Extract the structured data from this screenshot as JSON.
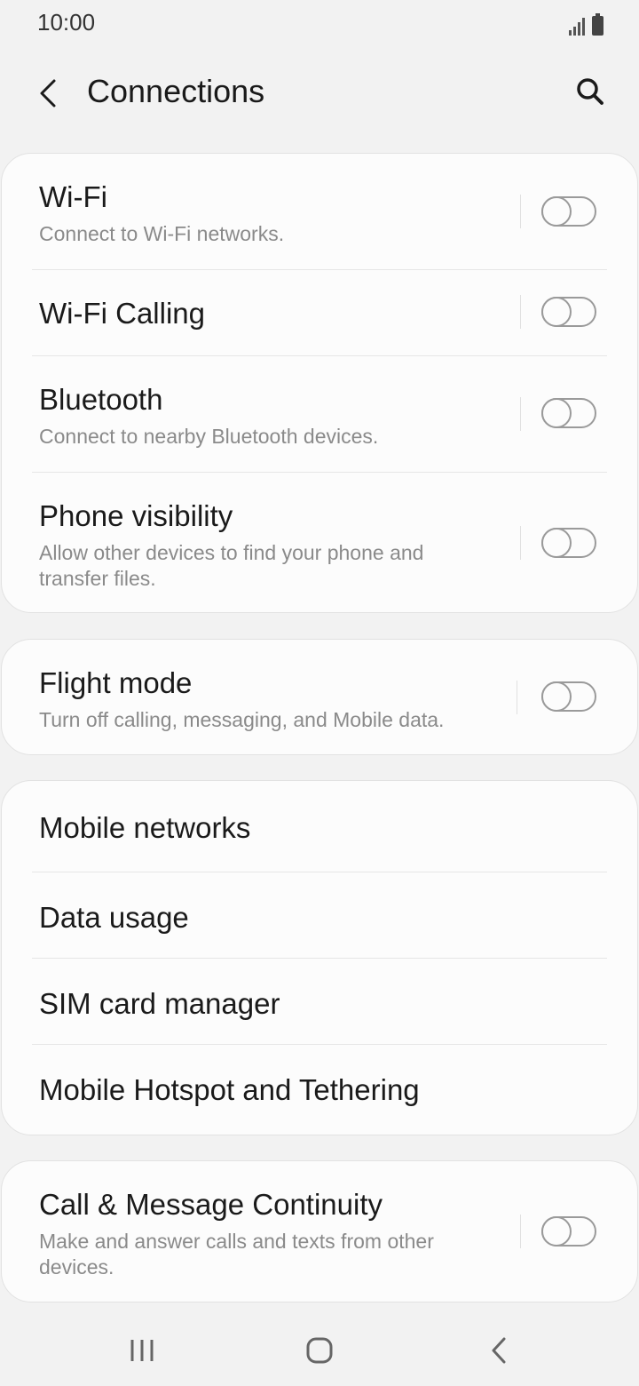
{
  "status_bar": {
    "time": "10:00"
  },
  "header": {
    "title": "Connections",
    "back_icon": "chevron-left-icon",
    "search_icon": "search-icon"
  },
  "groups": [
    {
      "items": [
        {
          "title": "Wi-Fi",
          "subtitle": "Connect to Wi-Fi networks.",
          "toggle": false
        },
        {
          "title": "Wi-Fi Calling",
          "subtitle": "",
          "toggle": false
        },
        {
          "title": "Bluetooth",
          "subtitle": "Connect to nearby Bluetooth devices.",
          "toggle": false
        },
        {
          "title": "Phone visibility",
          "subtitle": "Allow other devices to find your phone and transfer files.",
          "toggle": false
        }
      ]
    },
    {
      "items": [
        {
          "title": "Flight mode",
          "subtitle": "Turn off calling, messaging, and Mobile data.",
          "toggle": false
        }
      ]
    },
    {
      "items": [
        {
          "title": "Mobile networks"
        },
        {
          "title": "Data usage"
        },
        {
          "title": "SIM card manager"
        },
        {
          "title": "Mobile Hotspot and Tethering"
        }
      ]
    },
    {
      "items": [
        {
          "title": "Call & Message Continuity",
          "subtitle": "Make and answer calls and texts from other devices.",
          "toggle": false
        }
      ]
    }
  ],
  "nav_bar": {
    "recents_icon": "recent-apps-icon",
    "home_icon": "home-icon",
    "back_icon": "back-icon"
  },
  "colors": {
    "background": "#f2f2f2",
    "card": "#fcfcfc",
    "title_text": "#1a1a1a",
    "subtitle_text": "#8a8a8a",
    "toggle_off": "#9a9a9a"
  }
}
